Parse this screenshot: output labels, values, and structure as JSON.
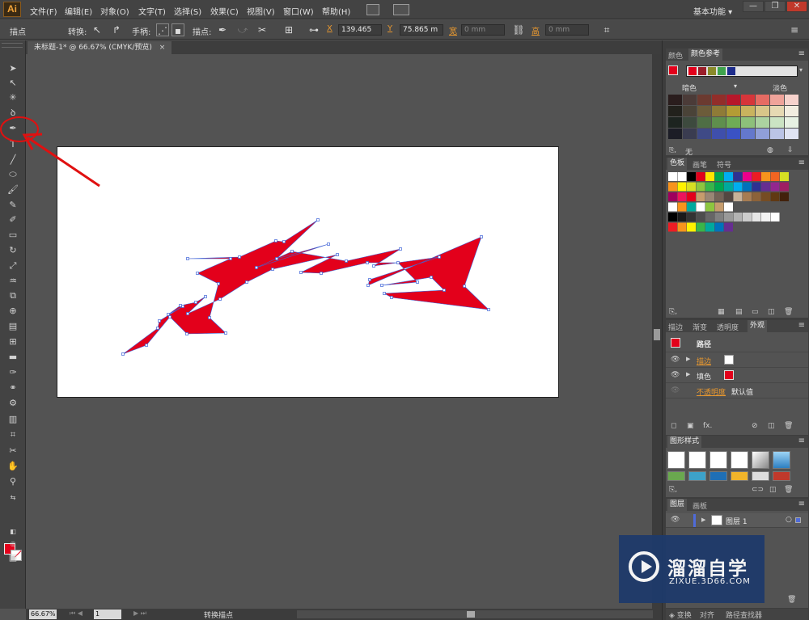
{
  "app": {
    "logo": "Ai",
    "menu": [
      "文件(F)",
      "编辑(E)",
      "对象(O)",
      "文字(T)",
      "选择(S)",
      "效果(C)",
      "视图(V)",
      "窗口(W)",
      "帮助(H)"
    ],
    "workspace": "基本功能",
    "window_buttons": [
      "—",
      "❐",
      "✕"
    ]
  },
  "control_bar": {
    "selection_label": "描点",
    "convert_label": "转换:",
    "handles_label": "手柄:",
    "anchors_label": "描点:",
    "x_label": "X",
    "x_value": "139.465",
    "y_label": "Y",
    "y_value": "75.865 m",
    "w_label": "宽",
    "w_value": "0 mm",
    "h_label": "高",
    "h_value": "0 mm"
  },
  "document": {
    "tab_title": "未标题-1* @ 66.67% (CMYK/预览)",
    "close": "×"
  },
  "status_bar": {
    "zoom": "66.67%",
    "artboard": "1",
    "mode": "转换描点"
  },
  "panels": {
    "color": {
      "tabs": [
        "颜色",
        "颜色参考"
      ],
      "shade_label": "暗色",
      "tint_label": "淡色",
      "none_label": "无",
      "accent": "#e3001b"
    },
    "swatches": {
      "tabs": [
        "色板",
        "画笔",
        "符号"
      ]
    },
    "appearance": {
      "tabs": [
        "描边",
        "渐变",
        "透明度",
        "外观"
      ],
      "title": "路径",
      "rows": [
        {
          "label": "描边",
          "value": ""
        },
        {
          "label": "填色",
          "value": ""
        },
        {
          "label": "不透明度",
          "value": "默认值"
        }
      ]
    },
    "graphic_styles": {
      "tabs": [
        "图形样式"
      ]
    },
    "layers": {
      "tabs": [
        "图层",
        "画板"
      ],
      "layer_name": "图层 1"
    },
    "bottom_tabs": [
      "变换",
      "对齐",
      "路径查找器"
    ]
  },
  "watermark": {
    "title": "溜溜自学",
    "url": "ZIXUE.3D66.COM"
  },
  "artwork": {
    "fill": "#e3001b",
    "anchor_color": "#3d63d8"
  }
}
